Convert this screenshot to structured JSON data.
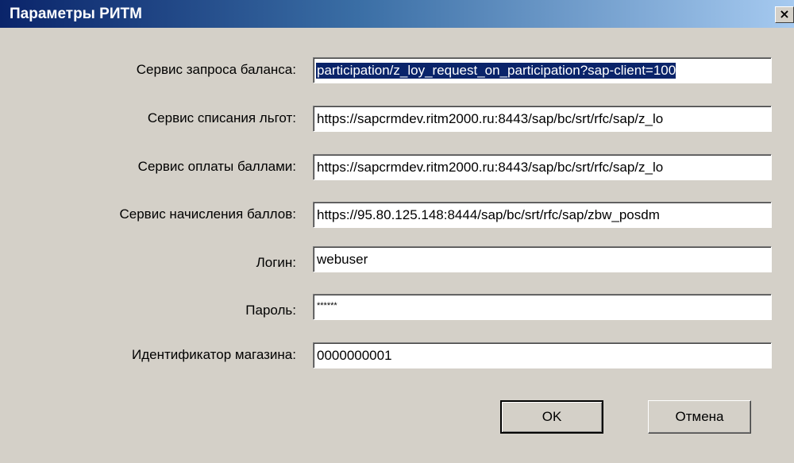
{
  "window": {
    "title": "Параметры РИТМ",
    "close_glyph": "×"
  },
  "fields": [
    {
      "label": "Сервис запроса баланса:",
      "value": "participation/z_loy_request_on_participation?sap-client=100"
    },
    {
      "label": "Сервис списания льгот:",
      "value": "https://sapcrmdev.ritm2000.ru:8443/sap/bc/srt/rfc/sap/z_lo"
    },
    {
      "label": "Сервис оплаты баллами:",
      "value": "https://sapcrmdev.ritm2000.ru:8443/sap/bc/srt/rfc/sap/z_lo"
    },
    {
      "label": "Сервис начисления баллов:",
      "value": "https://95.80.125.148:8444/sap/bc/srt/rfc/sap/zbw_posdm"
    },
    {
      "label": "Логин:",
      "value": "webuser"
    },
    {
      "label": "Пароль:",
      "value": "******"
    },
    {
      "label": "Идентификатор магазина:",
      "value": "0000000001"
    }
  ],
  "buttons": {
    "ok_label": "OK",
    "cancel_label": "Отмена"
  },
  "colors": {
    "title_gradient_start": "#0a246a",
    "title_gradient_end": "#a6caf0",
    "face": "#d4d0c8",
    "selection": "#0a246a"
  }
}
